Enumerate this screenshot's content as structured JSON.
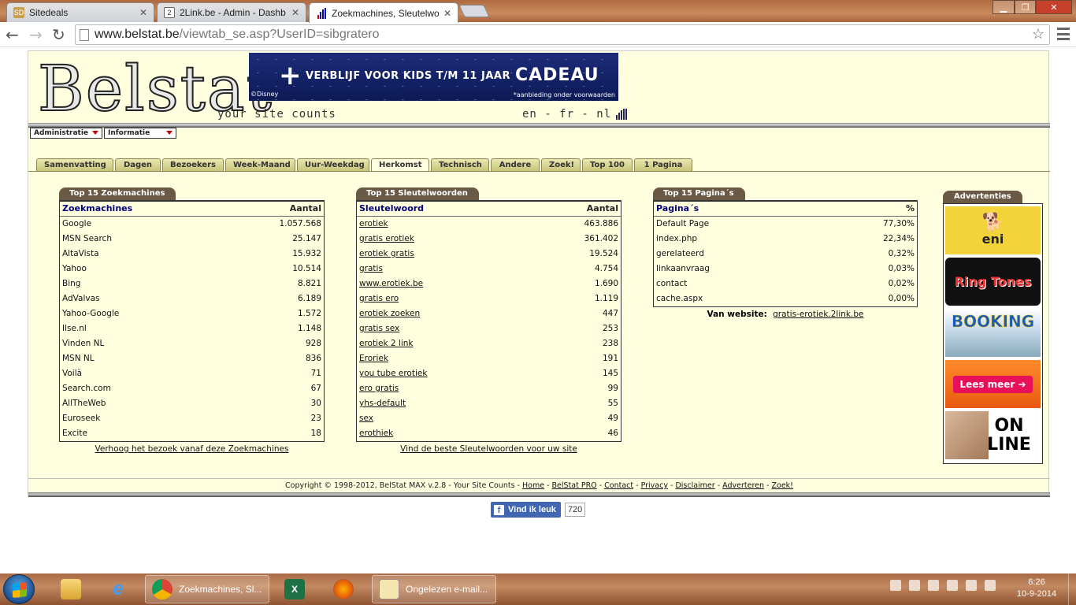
{
  "browser": {
    "tabs": [
      {
        "title": "Sitedeals",
        "favicon": "SD"
      },
      {
        "title": "2Link.be - Admin - Dashb",
        "favicon": "2"
      },
      {
        "title": "Zoekmachines, Sleutelwo",
        "favicon": "bars"
      }
    ],
    "url_host": "www.belstat.be",
    "url_path": "/viewtab_se.asp?UserID=sibgratero"
  },
  "header": {
    "logo": "Belstat",
    "slogan": "your site counts",
    "lang": "en - fr - nl",
    "banner": {
      "plus": "+",
      "text": "VERBLIJF VOOR KIDS T/M 11 JAAR",
      "big": "CADEAU",
      "disney": "©Disney",
      "cond": "*aanbieding onder voorwaarden"
    }
  },
  "dropdowns": {
    "admin": "Administratie",
    "info": "Informatie"
  },
  "tabs": [
    "Samenvatting",
    "Dagen",
    "Bezoekers",
    "Week-Maand",
    "Uur-Weekdag",
    "Herkomst",
    "Technisch",
    "Andere",
    "Zoek!",
    "Top 100",
    "1 Pagina"
  ],
  "search_engines": {
    "title": "Top 15 Zoekmachines",
    "col1": "Zoekmachines",
    "col2": "Aantal",
    "rows": [
      [
        "Google",
        "1.057.568"
      ],
      [
        "MSN Search",
        "25.147"
      ],
      [
        "AltaVista",
        "15.932"
      ],
      [
        "Yahoo",
        "10.514"
      ],
      [
        "Bing",
        "8.821"
      ],
      [
        "AdValvas",
        "6.189"
      ],
      [
        "Yahoo-Google",
        "1.572"
      ],
      [
        "Ilse.nl",
        "1.148"
      ],
      [
        "Vinden NL",
        "928"
      ],
      [
        "MSN NL",
        "836"
      ],
      [
        "Voilà",
        "71"
      ],
      [
        "Search.com",
        "67"
      ],
      [
        "AllTheWeb",
        "30"
      ],
      [
        "Euroseek",
        "23"
      ],
      [
        "Excite",
        "18"
      ]
    ],
    "footer": "Verhoog het bezoek vanaf deze Zoekmachines"
  },
  "keywords": {
    "title": "Top 15 Sleutelwoorden",
    "col1": "Sleutelwoord",
    "col2": "Aantal",
    "rows": [
      [
        "erotiek",
        "463.886"
      ],
      [
        "gratis erotiek",
        "361.402"
      ],
      [
        "erotiek gratis",
        "19.524"
      ],
      [
        "gratis",
        "4.754"
      ],
      [
        "www.erotiek.be",
        "1.690"
      ],
      [
        "gratis ero",
        "1.119"
      ],
      [
        "erotiek zoeken",
        "447"
      ],
      [
        "gratis sex",
        "253"
      ],
      [
        "erotiek 2 link",
        "238"
      ],
      [
        "Eroriek",
        "191"
      ],
      [
        "you tube erotiek",
        "145"
      ],
      [
        "ero gratis",
        "99"
      ],
      [
        "yhs-default",
        "55"
      ],
      [
        "sex",
        "49"
      ],
      [
        "erothiek",
        "46"
      ]
    ],
    "footer": "Vind de beste Sleutelwoorden voor uw site"
  },
  "pages": {
    "title": "Top 15 Pagina´s",
    "col1": "Pagina´s",
    "col2": "%",
    "rows": [
      [
        "Default Page",
        "77,30%"
      ],
      [
        "index.php",
        "22,34%"
      ],
      [
        "gerelateerd",
        "0,32%"
      ],
      [
        "linkaanvraag",
        "0,03%"
      ],
      [
        "contact",
        "0,02%"
      ],
      [
        "cache.aspx",
        "0,00%"
      ]
    ],
    "website_label": "Van website:",
    "website": "gratis-erotiek.2link.be"
  },
  "ads": {
    "title": "Advertenties",
    "items": [
      "eni",
      "Ring Tones",
      "BOOKING",
      "Lees meer",
      "ON LINE"
    ]
  },
  "footer": {
    "copyright": "Copyright © 1998-2012, BelStat MAX v.2.8 - Your Site Counts - ",
    "links": [
      "Home",
      "BelStat PRO",
      "Contact",
      "Privacy",
      "Disclaimer",
      "Adverteren",
      "Zoek!"
    ]
  },
  "facebook": {
    "label": "Vind ik leuk",
    "count": "720"
  },
  "taskbar": {
    "chrome_label": "Zoekmachines, Sl...",
    "mail_label": "Ongelezen e-mail...",
    "time": "6:26",
    "date": "10-9-2014"
  }
}
